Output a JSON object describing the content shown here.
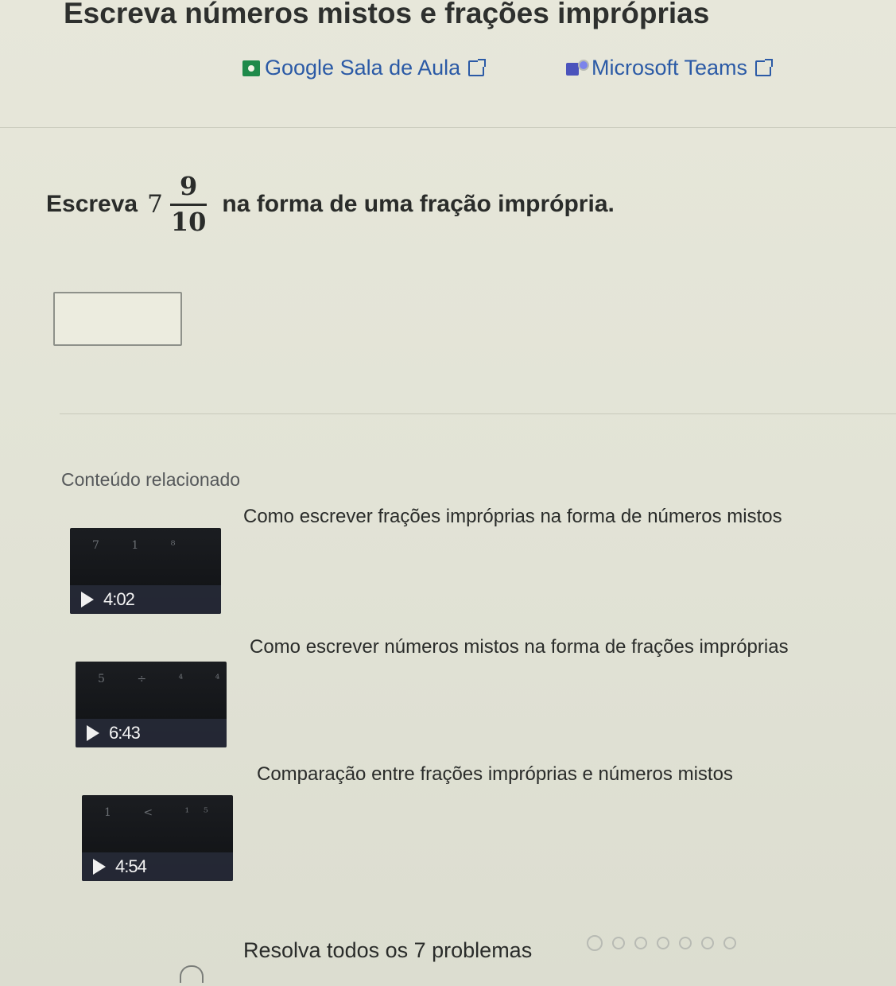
{
  "header": {
    "title": "Escreva números mistos e frações impróprias"
  },
  "share": {
    "google_classroom": "Google Sala de Aula",
    "microsoft_teams": "Microsoft Teams"
  },
  "question": {
    "prefix": "Escreva",
    "whole": "7",
    "numerator": "9",
    "denominator": "10",
    "suffix": "na forma de uma fração imprópria."
  },
  "related": {
    "heading": "Conteúdo relacionado",
    "videos": [
      {
        "title": "Como escrever frações impróprias na forma de números mistos",
        "duration": "4:02"
      },
      {
        "title": "Como escrever números mistos na forma de frações impróprias",
        "duration": "6:43"
      },
      {
        "title": "Comparação entre frações impróprias e números mistos",
        "duration": "4:54"
      }
    ]
  },
  "footer": {
    "text": "Resolva todos os 7 problemas",
    "problem_count": 7
  },
  "colors": {
    "link": "#2b5aa6",
    "background": "#e4e5d8",
    "google_classroom_green": "#1e8a4a",
    "teams_purple": "#4b53bc"
  }
}
